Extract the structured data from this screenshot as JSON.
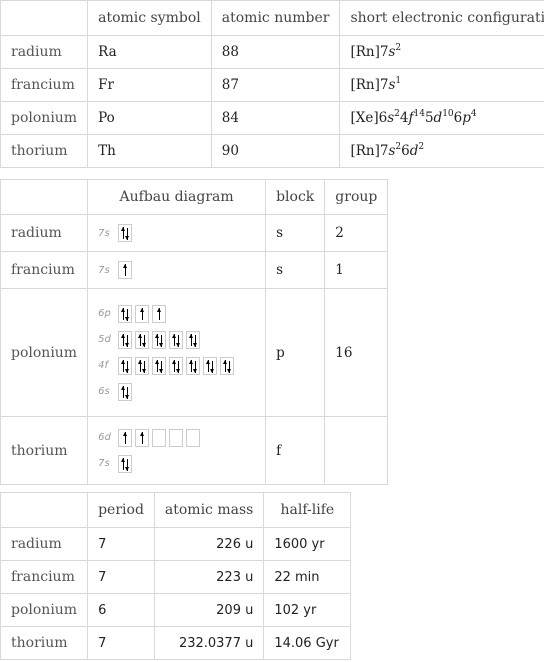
{
  "table1": {
    "headers": [
      "",
      "atomic symbol",
      "atomic number",
      "short electronic configuration"
    ],
    "rows": [
      {
        "name": "radium",
        "symbol": "Ra",
        "number": "88",
        "config": [
          {
            "t": "[Rn]7"
          },
          {
            "i": "s"
          },
          {
            "sup": "2"
          }
        ]
      },
      {
        "name": "francium",
        "symbol": "Fr",
        "number": "87",
        "config": [
          {
            "t": "[Rn]7"
          },
          {
            "i": "s"
          },
          {
            "sup": "1"
          }
        ]
      },
      {
        "name": "polonium",
        "symbol": "Po",
        "number": "84",
        "config": [
          {
            "t": "[Xe]6"
          },
          {
            "i": "s"
          },
          {
            "sup": "2"
          },
          {
            "t": "4"
          },
          {
            "i": "f"
          },
          {
            "sup": "14"
          },
          {
            "t": "5"
          },
          {
            "i": "d"
          },
          {
            "sup": "10"
          },
          {
            "t": "6"
          },
          {
            "i": "p"
          },
          {
            "sup": "4"
          }
        ]
      },
      {
        "name": "thorium",
        "symbol": "Th",
        "number": "90",
        "config": [
          {
            "t": "[Rn]7"
          },
          {
            "i": "s"
          },
          {
            "sup": "2"
          },
          {
            "t": "6"
          },
          {
            "i": "d"
          },
          {
            "sup": "2"
          }
        ]
      }
    ]
  },
  "table2": {
    "headers": [
      "",
      "Aufbau diagram",
      "block",
      "group"
    ],
    "rows": [
      {
        "name": "radium",
        "orbitals": [
          {
            "label": "7s",
            "boxes": [
              2
            ]
          }
        ],
        "block": "s",
        "group": "2"
      },
      {
        "name": "francium",
        "orbitals": [
          {
            "label": "7s",
            "boxes": [
              1
            ]
          }
        ],
        "block": "s",
        "group": "1"
      },
      {
        "name": "polonium",
        "orbitals": [
          {
            "label": "6p",
            "boxes": [
              2,
              1,
              1
            ]
          },
          {
            "label": "5d",
            "boxes": [
              2,
              2,
              2,
              2,
              2
            ]
          },
          {
            "label": "4f",
            "boxes": [
              2,
              2,
              2,
              2,
              2,
              2,
              2
            ]
          },
          {
            "label": "6s",
            "boxes": [
              2
            ]
          }
        ],
        "block": "p",
        "group": "16"
      },
      {
        "name": "thorium",
        "orbitals": [
          {
            "label": "6d",
            "boxes": [
              1,
              1,
              0,
              0,
              0
            ]
          },
          {
            "label": "7s",
            "boxes": [
              2
            ]
          }
        ],
        "block": "f",
        "group": ""
      }
    ]
  },
  "table3": {
    "headers": [
      "",
      "period",
      "atomic mass",
      "half-life"
    ],
    "rows": [
      {
        "name": "radium",
        "period": "7",
        "mass": "226 u",
        "halflife": "1600 yr"
      },
      {
        "name": "francium",
        "period": "7",
        "mass": "223 u",
        "halflife": "22 min"
      },
      {
        "name": "polonium",
        "period": "6",
        "mass": "209 u",
        "halflife": "102 yr"
      },
      {
        "name": "thorium",
        "period": "7",
        "mass": "232.0377 u",
        "halflife": "14.06 Gyr"
      }
    ]
  }
}
